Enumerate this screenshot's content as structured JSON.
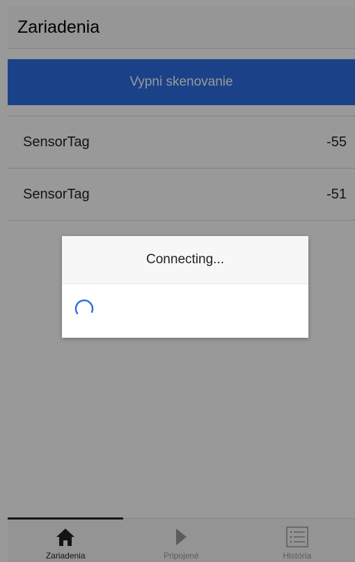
{
  "header": {
    "title": "Zariadenia"
  },
  "scan_button": {
    "label": "Vypni skenovanie"
  },
  "devices": [
    {
      "name": "SensorTag",
      "rssi": "-55"
    },
    {
      "name": "SensorTag",
      "rssi": "-51"
    }
  ],
  "dialog": {
    "title": "Connecting..."
  },
  "tabs": [
    {
      "label": "Zariadenia",
      "icon": "home-icon",
      "active": true
    },
    {
      "label": "Pripojené",
      "icon": "play-icon",
      "active": false
    },
    {
      "label": "História",
      "icon": "list-icon",
      "active": false
    }
  ],
  "colors": {
    "primary": "#2e6fe4",
    "spinner": "#2e6fe4"
  }
}
